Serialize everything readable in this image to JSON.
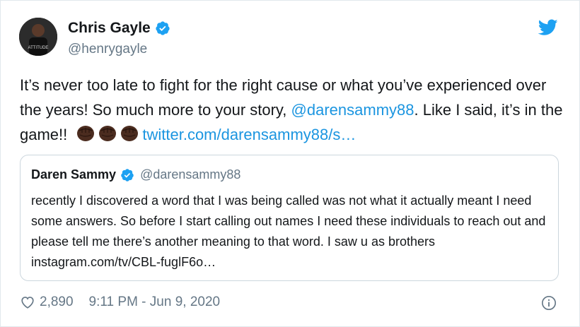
{
  "author": {
    "name": "Chris Gayle",
    "handle": "@henrygayle",
    "verified": true,
    "avatar_icon": "profile-photo"
  },
  "tweet": {
    "text_part1": "It’s never too late to fight for the right cause or what you’ve experienced over the years! So much more to your story, ",
    "mention": "@darensammy88",
    "text_part2": ". Like I said, it’s in the game!! ",
    "emoji_names": [
      "raised-fist-dark-skin-emoji",
      "raised-fist-dark-skin-emoji",
      "raised-fist-dark-skin-emoji"
    ],
    "link": "twitter.com/darensammy88/s…"
  },
  "quoted_tweet": {
    "name": "Daren Sammy",
    "handle": "@darensammy88",
    "verified": true,
    "text": "recently I discovered a word that I was being called was not what it actually meant I need some answers. So before I start calling out names I need these individuals to reach out and please tell me there’s another meaning to that word. I saw u as brothers instagram.com/tv/CBL-fuglF6o…"
  },
  "footer": {
    "like_count": "2,890",
    "timestamp": "9:11 PM - Jun 9, 2020"
  },
  "colors": {
    "link": "#1b95e0",
    "verified": "#1da1f2",
    "secondary_text": "#657786",
    "border": "#e1e8ed"
  },
  "icons": [
    "twitter-bird-icon",
    "verified-badge-icon",
    "heart-icon",
    "info-icon"
  ]
}
